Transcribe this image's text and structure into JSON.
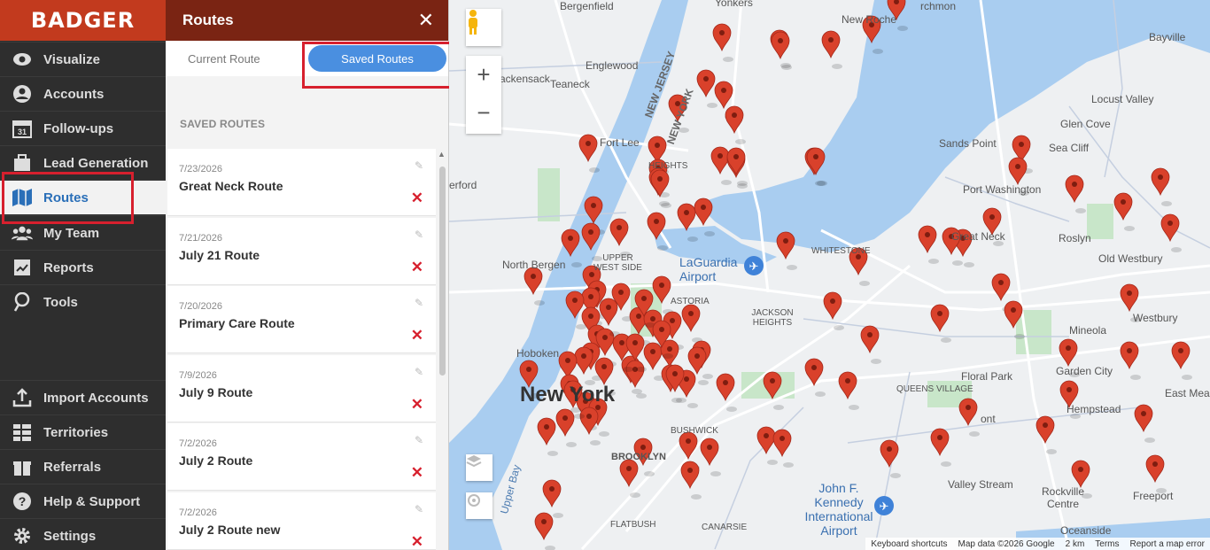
{
  "app": {
    "logo": "BADGER"
  },
  "nav": {
    "items": [
      {
        "label": "Visualize",
        "icon": "eye-icon"
      },
      {
        "label": "Accounts",
        "icon": "user-icon"
      },
      {
        "label": "Follow-ups",
        "icon": "calendar-icon"
      },
      {
        "label": "Lead Generation",
        "icon": "lead-icon"
      },
      {
        "label": "Routes",
        "icon": "map-icon",
        "active": true
      },
      {
        "label": "My Team",
        "icon": "team-icon"
      },
      {
        "label": "Reports",
        "icon": "reports-icon"
      },
      {
        "label": "Tools",
        "icon": "tools-icon"
      }
    ],
    "bottom_items": [
      {
        "label": "Import Accounts",
        "icon": "upload-icon"
      },
      {
        "label": "Territories",
        "icon": "grid-icon"
      },
      {
        "label": "Referrals",
        "icon": "gift-icon"
      },
      {
        "label": "Help & Support",
        "icon": "help-icon"
      },
      {
        "label": "Settings",
        "icon": "gear-icon"
      }
    ],
    "calendar_day": "31"
  },
  "panel": {
    "title": "Routes",
    "close": "✕",
    "tabs": {
      "current": "Current Route",
      "saved": "Saved Routes"
    },
    "saved_heading": "SAVED ROUTES",
    "routes": [
      {
        "date": "7/23/2026",
        "name": "Great Neck Route"
      },
      {
        "date": "7/21/2026",
        "name": "July 21 Route"
      },
      {
        "date": "7/20/2026",
        "name": "Primary Care Route"
      },
      {
        "date": "7/9/2026",
        "name": "July 9 Route"
      },
      {
        "date": "7/2/2026",
        "name": "July 2 Route"
      },
      {
        "date": "7/2/2026",
        "name": "July 2 Route new"
      }
    ]
  },
  "map": {
    "zoom_in": "+",
    "zoom_out": "−",
    "labels": {
      "bergenfield": "Bergenfield",
      "yonkers": "Yonkers",
      "new_rochelle": "New Roche",
      "archmon": "rchmon",
      "bayville": "Bayville",
      "englewood": "Englewood",
      "hackensack": "ackensack",
      "teaneck": "Teaneck",
      "new_jersey": "NEW JERSEY",
      "new_york_state": "NEW YORK",
      "locust_valley": "Locust Valley",
      "glen_cove": "Glen Cove",
      "fort_lee": "Fort Lee",
      "sands_point": "Sands Point",
      "sea_cliff": "Sea Cliff",
      "port_washington": "Port Washington",
      "heights": "HEIGHTS",
      "erford": "erford",
      "great_neck": "Great Neck",
      "roslyn": "Roslyn",
      "old_westbury": "Old Westbury",
      "north_bergen": "North Bergen",
      "upper_west_side": "UPPER WEST SIDE",
      "laguardia": "LaGuardia Airport",
      "whitestone": "WHITESTONE",
      "astoria": "ASTORIA",
      "jackson_heights": "JACKSON HEIGHTS",
      "mineola": "Mineola",
      "westbury": "Westbury",
      "hoboken": "Hoboken",
      "floral_park": "Floral Park",
      "garden_city": "Garden City",
      "east_meadow": "East Meado",
      "new_york": "New York",
      "queens_village": "QUEENS VILLAGE",
      "hempstead": "Hempstead",
      "bushwick": "BUSHWICK",
      "mont": "ont",
      "brooklyn": "BROOKLYN",
      "upper_bay": "Upper Bay",
      "jfk": "John F. Kennedy International Airport",
      "valley_stream": "Valley Stream",
      "rockville_centre": "Rockville Centre",
      "freeport": "Freeport",
      "flatbush": "FLATBUSH",
      "canarsie": "CANARSIE",
      "oceanside": "Oceanside"
    },
    "attribution": {
      "shortcuts": "Keyboard shortcuts",
      "data": "Map data ©2026 Google",
      "scale": "2 km",
      "terms": "Terms",
      "report": "Report a map error"
    },
    "marker_count": 110
  },
  "colors": {
    "brand": "#c23a1e",
    "header": "#7a2413",
    "accent": "#4a8fe0",
    "marker": "#d9412b",
    "highlight": "#d7202e"
  }
}
